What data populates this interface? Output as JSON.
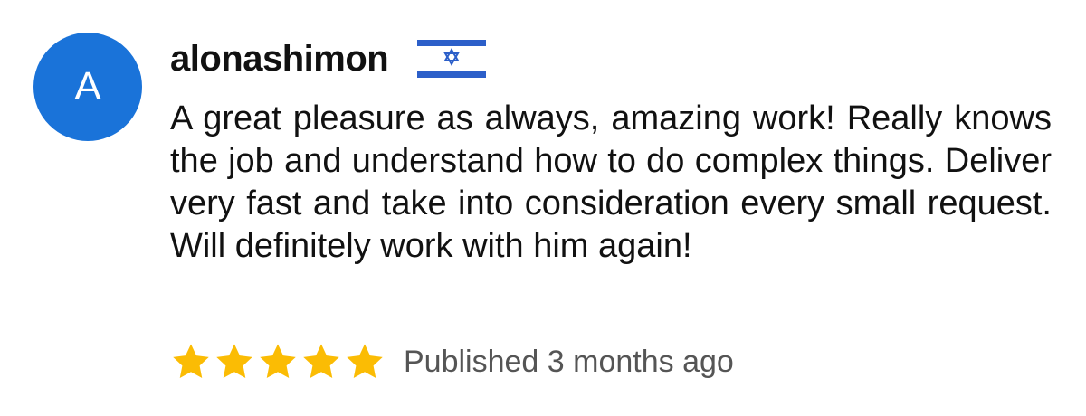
{
  "review": {
    "avatar_letter": "A",
    "username": "alonashimon",
    "country_flag_icon": "israel-flag-icon",
    "text": "A great pleasure as always, amazing work! Really knows the job and understand how to do complex things. Deliver very fast and take into consideration every small request. Will definitely work with him again!",
    "rating": 5,
    "rating_max": 5,
    "published": "Published 3 months ago"
  },
  "colors": {
    "avatar_bg": "#1a73d9",
    "star": "#fbbc04",
    "flag_blue": "#2c5fc9",
    "meta_text": "#555555"
  }
}
